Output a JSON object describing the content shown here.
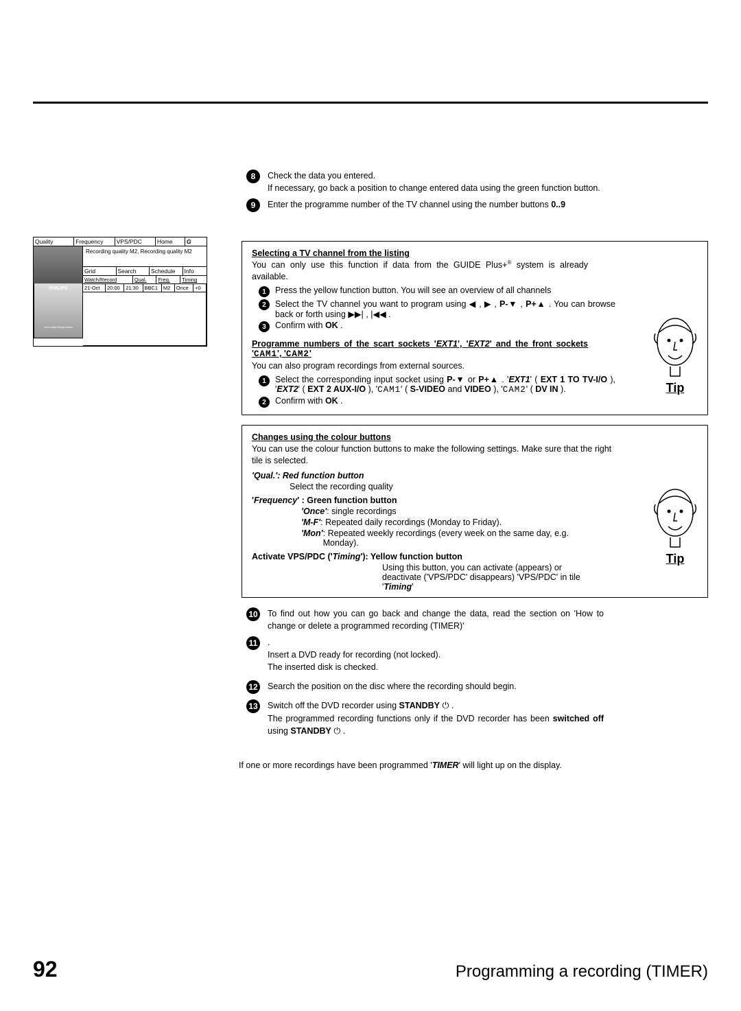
{
  "steps": {
    "s8": {
      "num": "8",
      "line1": "Check the data you entered.",
      "line2": "If necessary, go back a position to change entered data using the green function button."
    },
    "s9": {
      "num": "9",
      "line1": "Enter the programme number of the TV channel using the number buttons",
      "line1b": "0..9"
    },
    "s10": {
      "num": "10",
      "text": "To find out how you can go back and change the data, read the section on 'How to change or delete a programmed recording (TIMER)'"
    },
    "s11": {
      "num": "11",
      "line0": ".",
      "line1": "Insert a DVD ready for recording (not locked).",
      "line2": "The inserted disk is checked."
    },
    "s12": {
      "num": "12",
      "text": "Search the position on the disc where the recording should begin."
    },
    "s13": {
      "num": "13",
      "line1a": "Switch off the DVD recorder using ",
      "line1b": "STANDBY",
      "line1c": " .",
      "line2a": "The programmed recording functions only if the DVD recorder has been ",
      "line2b": "switched off",
      "line2c": " using ",
      "line2d": "STANDBY",
      "line2e": " ."
    }
  },
  "tip1": {
    "head": "Selecting a TV channel from the listing",
    "intro_a": "You can only use this function if data from the GUIDE Plus+",
    "intro_b": " system is already available.",
    "reg": "®",
    "sub1": "Press the yellow function button. You will see an overview of all channels",
    "sub2a": "Select the TV channel you want to program using ",
    "sub2b": ". You can browse back or forth using ",
    "sub3a": "Confirm with ",
    "sub3b": "OK",
    "sub3c": " .",
    "head2a": "Programme numbers of the scart sockets '",
    "head2b": "EXT1",
    "head2c": "', '",
    "head2d": "EXT2",
    "head2e": "' and the front sockets '",
    "head2f": "CAM1",
    "head2g": "', '",
    "head2h": "CAM2",
    "head2i": "'",
    "intro2": "You can also program recordings from external sources.",
    "sub4a": "Select the corresponding input socket using ",
    "sub4b": ". '",
    "sub4c": "EXT1",
    "sub4d": "' ( ",
    "sub4e": "EXT 1 TO TV-I/O",
    "sub4f": " ), '",
    "sub4g": "EXT2",
    "sub4h": "' ( ",
    "sub4i": "EXT 2 AUX-I/O",
    "sub4j": " ), '",
    "sub4k": "CAM1",
    "sub4l": "' ( ",
    "sub4m": "S-VIDEO",
    "sub4n": " and ",
    "sub4o": "VIDEO",
    "sub4p": " ), '",
    "sub4q": "CAM2",
    "sub4r": "' ( ",
    "sub4s": "DV IN",
    "sub4t": " ).",
    "sub5a": "Confirm with ",
    "sub5b": "OK",
    "sub5c": " .",
    "label": "Tip",
    "nums": {
      "n1": "1",
      "n2": "2",
      "n3": "3"
    },
    "arrows": {
      "left": "◀",
      "right": "▶",
      "pminus": "P-▼",
      "pplus": "P+▲",
      "fwd": "▶▶|",
      "rew": "|◀◀"
    }
  },
  "tip2": {
    "head": "Changes using the colour buttons",
    "intro": "You can use the colour function buttons to make the following settings. Make sure that the right tile is selected.",
    "qual_head": "'Qual.': Red function button",
    "qual_body": "Select the recording quality",
    "freq_head_a": "'",
    "freq_head_b": "Frequency",
    "freq_head_c": "' : Green function button",
    "freq_once_lbl": "'Once'",
    "freq_once_body": ": single recordings",
    "freq_mf_lbl": "'M-F'",
    "freq_mf_body": ": Repeated daily recordings (Monday to Friday).",
    "freq_mon_lbl": "'Mon'",
    "freq_mon_body": ": Repeated weekly recordings (every week on the same day, e.g. Monday).",
    "vps_head_a": "Activate VPS/PDC ('",
    "vps_head_b": "Timing",
    "vps_head_c": "'): Yellow function button",
    "vps_body1": "Using this button, you can activate (appears) or deactivate ('VPS/PDC' disappears) 'VPS/PDC' in tile '",
    "vps_body2": "Timing",
    "vps_body3": "'",
    "label": "Tip"
  },
  "finalnote": {
    "a": "If one or more recordings have been programmed '",
    "b": "TIMER",
    "c": "' will light up on the display."
  },
  "grid": {
    "tabs": {
      "quality": "Quality",
      "frequency": "Frequency",
      "vpspdc": "VPS/PDC",
      "home": "Home",
      "logo": "G"
    },
    "banner": "Recording quality M2, Recording quality M2",
    "row2": {
      "grid": "Grid",
      "search": "Search",
      "schedule": "Schedule",
      "info": "Info"
    },
    "row3": {
      "watchrecord": "Watch/Record",
      "qual": "Qual.",
      "freq": "Freq.",
      "timing": "Timing"
    },
    "row4": {
      "date": "21-Oct",
      "t1": "20:00",
      "t2": "21:30",
      "ch": "BBC1",
      "q": "M2",
      "once": "Once",
      "plus": "+0"
    },
    "device": {
      "brand": "PHILIPS",
      "tagline": "Let's make things better"
    }
  },
  "icons": {
    "power": "⏻"
  },
  "footer": {
    "page": "92",
    "chapter": "Programming a recording (TIMER)"
  }
}
